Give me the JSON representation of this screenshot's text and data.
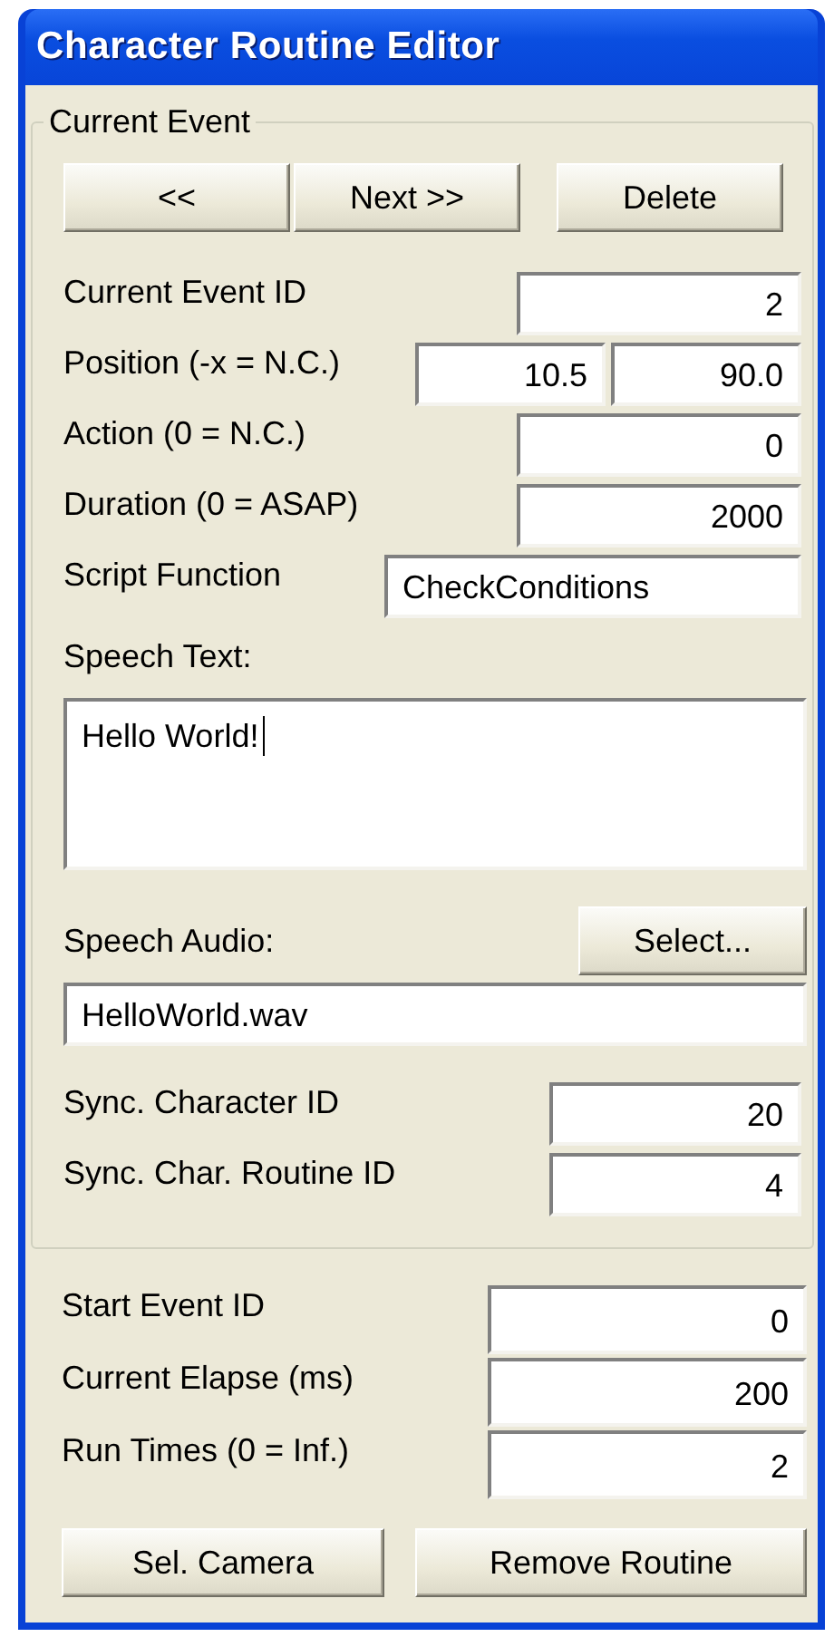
{
  "window": {
    "title": "Character Routine Editor"
  },
  "current_event": {
    "title": "Current Event",
    "nav_buttons": [
      "<<",
      "Next >>",
      "Delete"
    ],
    "fields": [
      {
        "kind": "number",
        "label": "Current Event ID",
        "values": [
          "2"
        ]
      },
      {
        "kind": "number",
        "label": "Position (-x = N.C.)",
        "values": [
          "10.5",
          "90.0"
        ]
      },
      {
        "kind": "number",
        "label": "Action (0 = N.C.)",
        "values": [
          "0"
        ]
      },
      {
        "kind": "number",
        "label": "Duration (0 = ASAP)",
        "values": [
          "2000"
        ]
      },
      {
        "kind": "text",
        "label": "Script Function",
        "values": [
          "CheckConditions"
        ]
      }
    ],
    "speech_text": {
      "label": "Speech Text:",
      "value": "Hello World!",
      "focused": true
    },
    "speech_audio": {
      "label": "Speech Audio:",
      "button": "Select...",
      "value": "HelloWorld.wav"
    },
    "sync_fields": [
      {
        "label": "Sync. Character ID",
        "value": "20"
      },
      {
        "label": "Sync. Char. Routine ID",
        "value": "4"
      }
    ]
  },
  "routine_fields": [
    {
      "label": "Start Event ID",
      "value": "0"
    },
    {
      "label": "Current Elapse (ms)",
      "value": "200"
    },
    {
      "label": "Run Times (0 = Inf.)",
      "value": "2"
    }
  ],
  "buttons": [
    "Sel. Camera",
    "Remove Routine"
  ]
}
